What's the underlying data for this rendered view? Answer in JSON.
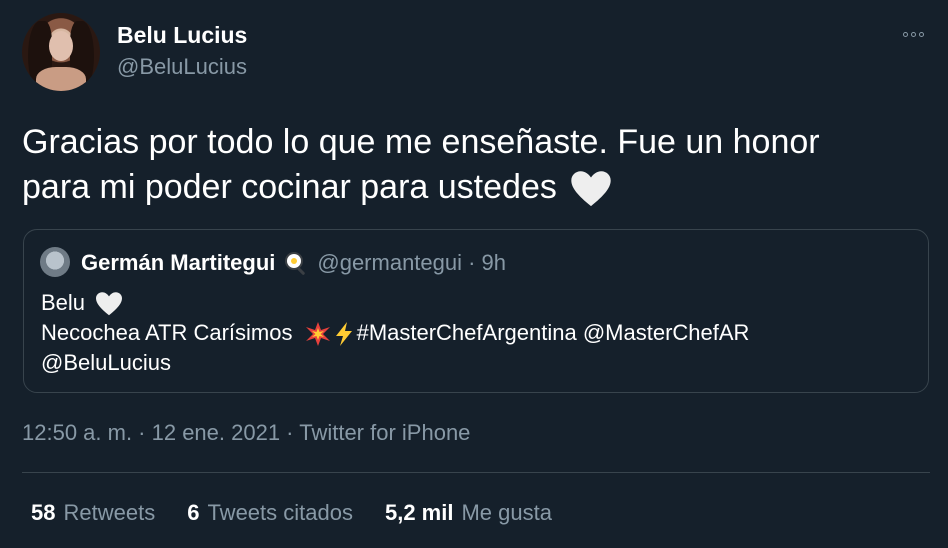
{
  "author": {
    "name": "Belu Lucius",
    "handle": "@BeluLucius"
  },
  "tweet": {
    "line1": "Gracias por todo lo que me enseñaste. Fue un honor",
    "line2": "para mi poder cocinar para ustedes",
    "emoji": "white-heart"
  },
  "quote": {
    "name": "Germán Martitegui",
    "name_emoji": "frying-pan-egg",
    "meta": "@germantegui · 9h",
    "line1": "Belu",
    "line2_text": "Necochea ATR Carísimos",
    "line2_emojis": [
      "collision",
      "high-voltage"
    ],
    "hashtag": "#MasterChefArgentina",
    "mention1": "@MasterChefAR",
    "mention2": "@BeluLucius"
  },
  "timestamp": "12:50 a. m. · 12 ene. 2021 · Twitter for iPhone",
  "stats": {
    "retweets_count": "58",
    "retweets_label": "Retweets",
    "quotes_count": "6",
    "quotes_label": "Tweets citados",
    "likes_count": "5,2 mil",
    "likes_label": "Me gusta"
  },
  "colors": {
    "background": "#15202b",
    "secondary_text": "#8899a6",
    "border": "#38444d"
  }
}
